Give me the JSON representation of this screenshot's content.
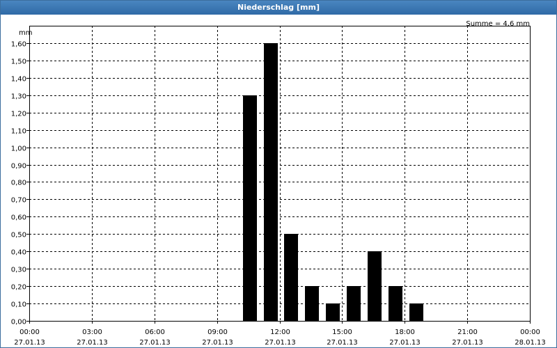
{
  "window": {
    "title": "Niederschlag [mm]"
  },
  "chart_data": {
    "type": "bar",
    "title": "Niederschlag [mm]",
    "y_unit": "mm",
    "summary": "Summe = 4,6 mm",
    "ylim": [
      0,
      1.7
    ],
    "y_ticks": [
      {
        "value": 0.0,
        "label": "0,00"
      },
      {
        "value": 0.1,
        "label": "0,10"
      },
      {
        "value": 0.2,
        "label": "0,20"
      },
      {
        "value": 0.3,
        "label": "0,30"
      },
      {
        "value": 0.4,
        "label": "0,40"
      },
      {
        "value": 0.5,
        "label": "0,50"
      },
      {
        "value": 0.6,
        "label": "0,60"
      },
      {
        "value": 0.7,
        "label": "0,70"
      },
      {
        "value": 0.8,
        "label": "0,80"
      },
      {
        "value": 0.9,
        "label": "0,90"
      },
      {
        "value": 1.0,
        "label": "1,00"
      },
      {
        "value": 1.1,
        "label": "1,10"
      },
      {
        "value": 1.2,
        "label": "1,20"
      },
      {
        "value": 1.3,
        "label": "1,30"
      },
      {
        "value": 1.4,
        "label": "1,40"
      },
      {
        "value": 1.5,
        "label": "1,50"
      },
      {
        "value": 1.6,
        "label": "1,60"
      }
    ],
    "xlim_hours": [
      0,
      24
    ],
    "x_ticks": [
      {
        "hour": 0,
        "time": "00:00",
        "date": "27.01.13"
      },
      {
        "hour": 3,
        "time": "03:00",
        "date": "27.01.13"
      },
      {
        "hour": 6,
        "time": "06:00",
        "date": "27.01.13"
      },
      {
        "hour": 9,
        "time": "09:00",
        "date": "27.01.13"
      },
      {
        "hour": 12,
        "time": "12:00",
        "date": "27.01.13"
      },
      {
        "hour": 15,
        "time": "15:00",
        "date": "27.01.13"
      },
      {
        "hour": 18,
        "time": "18:00",
        "date": "27.01.13"
      },
      {
        "hour": 21,
        "time": "21:00",
        "date": "27.01.13"
      },
      {
        "hour": 24,
        "time": "00:00",
        "date": "28.01.13"
      }
    ],
    "bars": [
      {
        "hour": 11,
        "value": 1.3
      },
      {
        "hour": 12,
        "value": 1.6
      },
      {
        "hour": 13,
        "value": 0.5
      },
      {
        "hour": 14,
        "value": 0.2
      },
      {
        "hour": 15,
        "value": 0.1
      },
      {
        "hour": 16,
        "value": 0.2
      },
      {
        "hour": 17,
        "value": 0.4
      },
      {
        "hour": 18,
        "value": 0.2
      },
      {
        "hour": 19,
        "value": 0.1
      }
    ],
    "bar_color": "#000000",
    "grid": true,
    "grid_style": "dashed"
  }
}
